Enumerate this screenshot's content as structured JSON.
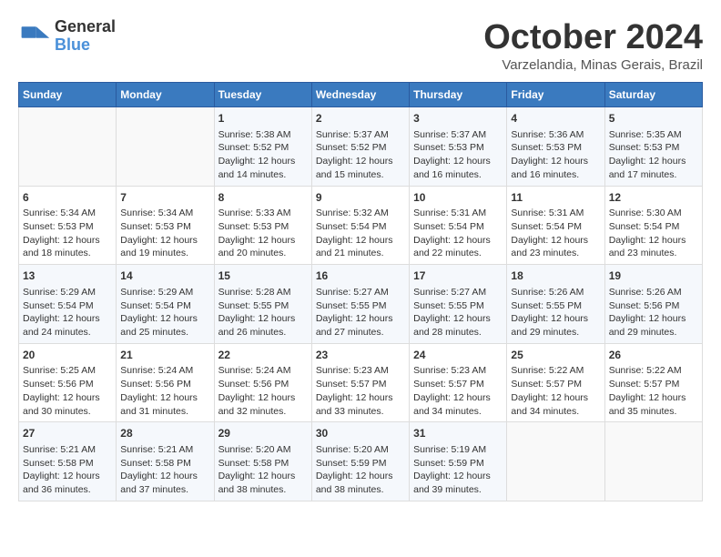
{
  "logo": {
    "line1": "General",
    "line2": "Blue"
  },
  "title": "October 2024",
  "location": "Varzelandia, Minas Gerais, Brazil",
  "days_of_week": [
    "Sunday",
    "Monday",
    "Tuesday",
    "Wednesday",
    "Thursday",
    "Friday",
    "Saturday"
  ],
  "weeks": [
    [
      {
        "day": "",
        "content": ""
      },
      {
        "day": "",
        "content": ""
      },
      {
        "day": "1",
        "content": "Sunrise: 5:38 AM\nSunset: 5:52 PM\nDaylight: 12 hours\nand 14 minutes."
      },
      {
        "day": "2",
        "content": "Sunrise: 5:37 AM\nSunset: 5:52 PM\nDaylight: 12 hours\nand 15 minutes."
      },
      {
        "day": "3",
        "content": "Sunrise: 5:37 AM\nSunset: 5:53 PM\nDaylight: 12 hours\nand 16 minutes."
      },
      {
        "day": "4",
        "content": "Sunrise: 5:36 AM\nSunset: 5:53 PM\nDaylight: 12 hours\nand 16 minutes."
      },
      {
        "day": "5",
        "content": "Sunrise: 5:35 AM\nSunset: 5:53 PM\nDaylight: 12 hours\nand 17 minutes."
      }
    ],
    [
      {
        "day": "6",
        "content": "Sunrise: 5:34 AM\nSunset: 5:53 PM\nDaylight: 12 hours\nand 18 minutes."
      },
      {
        "day": "7",
        "content": "Sunrise: 5:34 AM\nSunset: 5:53 PM\nDaylight: 12 hours\nand 19 minutes."
      },
      {
        "day": "8",
        "content": "Sunrise: 5:33 AM\nSunset: 5:53 PM\nDaylight: 12 hours\nand 20 minutes."
      },
      {
        "day": "9",
        "content": "Sunrise: 5:32 AM\nSunset: 5:54 PM\nDaylight: 12 hours\nand 21 minutes."
      },
      {
        "day": "10",
        "content": "Sunrise: 5:31 AM\nSunset: 5:54 PM\nDaylight: 12 hours\nand 22 minutes."
      },
      {
        "day": "11",
        "content": "Sunrise: 5:31 AM\nSunset: 5:54 PM\nDaylight: 12 hours\nand 23 minutes."
      },
      {
        "day": "12",
        "content": "Sunrise: 5:30 AM\nSunset: 5:54 PM\nDaylight: 12 hours\nand 23 minutes."
      }
    ],
    [
      {
        "day": "13",
        "content": "Sunrise: 5:29 AM\nSunset: 5:54 PM\nDaylight: 12 hours\nand 24 minutes."
      },
      {
        "day": "14",
        "content": "Sunrise: 5:29 AM\nSunset: 5:54 PM\nDaylight: 12 hours\nand 25 minutes."
      },
      {
        "day": "15",
        "content": "Sunrise: 5:28 AM\nSunset: 5:55 PM\nDaylight: 12 hours\nand 26 minutes."
      },
      {
        "day": "16",
        "content": "Sunrise: 5:27 AM\nSunset: 5:55 PM\nDaylight: 12 hours\nand 27 minutes."
      },
      {
        "day": "17",
        "content": "Sunrise: 5:27 AM\nSunset: 5:55 PM\nDaylight: 12 hours\nand 28 minutes."
      },
      {
        "day": "18",
        "content": "Sunrise: 5:26 AM\nSunset: 5:55 PM\nDaylight: 12 hours\nand 29 minutes."
      },
      {
        "day": "19",
        "content": "Sunrise: 5:26 AM\nSunset: 5:56 PM\nDaylight: 12 hours\nand 29 minutes."
      }
    ],
    [
      {
        "day": "20",
        "content": "Sunrise: 5:25 AM\nSunset: 5:56 PM\nDaylight: 12 hours\nand 30 minutes."
      },
      {
        "day": "21",
        "content": "Sunrise: 5:24 AM\nSunset: 5:56 PM\nDaylight: 12 hours\nand 31 minutes."
      },
      {
        "day": "22",
        "content": "Sunrise: 5:24 AM\nSunset: 5:56 PM\nDaylight: 12 hours\nand 32 minutes."
      },
      {
        "day": "23",
        "content": "Sunrise: 5:23 AM\nSunset: 5:57 PM\nDaylight: 12 hours\nand 33 minutes."
      },
      {
        "day": "24",
        "content": "Sunrise: 5:23 AM\nSunset: 5:57 PM\nDaylight: 12 hours\nand 34 minutes."
      },
      {
        "day": "25",
        "content": "Sunrise: 5:22 AM\nSunset: 5:57 PM\nDaylight: 12 hours\nand 34 minutes."
      },
      {
        "day": "26",
        "content": "Sunrise: 5:22 AM\nSunset: 5:57 PM\nDaylight: 12 hours\nand 35 minutes."
      }
    ],
    [
      {
        "day": "27",
        "content": "Sunrise: 5:21 AM\nSunset: 5:58 PM\nDaylight: 12 hours\nand 36 minutes."
      },
      {
        "day": "28",
        "content": "Sunrise: 5:21 AM\nSunset: 5:58 PM\nDaylight: 12 hours\nand 37 minutes."
      },
      {
        "day": "29",
        "content": "Sunrise: 5:20 AM\nSunset: 5:58 PM\nDaylight: 12 hours\nand 38 minutes."
      },
      {
        "day": "30",
        "content": "Sunrise: 5:20 AM\nSunset: 5:59 PM\nDaylight: 12 hours\nand 38 minutes."
      },
      {
        "day": "31",
        "content": "Sunrise: 5:19 AM\nSunset: 5:59 PM\nDaylight: 12 hours\nand 39 minutes."
      },
      {
        "day": "",
        "content": ""
      },
      {
        "day": "",
        "content": ""
      }
    ]
  ]
}
